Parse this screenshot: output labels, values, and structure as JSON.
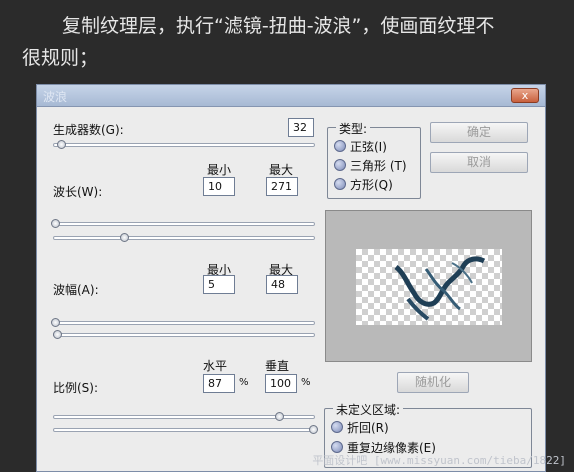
{
  "caption": {
    "line1": "复制纹理层，执行“滤镜-扭曲-波浪”，使画面纹理不",
    "line2": "很规则；"
  },
  "dialog": {
    "title": "波浪",
    "close": "x",
    "generators": {
      "label": "生成器数(G):",
      "value": "32"
    },
    "wavelength": {
      "label": "波长(W):",
      "min_label": "最小",
      "max_label": "最大",
      "min": "10",
      "max": "271"
    },
    "amplitude": {
      "label": "波幅(A):",
      "min_label": "最小",
      "max_label": "最大",
      "min": "5",
      "max": "48"
    },
    "scale": {
      "label": "比例(S):",
      "h_label": "水平",
      "v_label": "垂直",
      "h": "87",
      "v": "100",
      "unit": "%"
    },
    "type": {
      "title": "类型:",
      "options": [
        "正弦(I)",
        "三角形 (T)",
        "方形(Q)"
      ]
    },
    "buttons": {
      "ok": "确定",
      "cancel": "取消",
      "randomize": "随机化"
    },
    "undefined": {
      "title": "未定义区域:",
      "options": [
        "折回(R)",
        "重复边缘像素(E)"
      ]
    }
  },
  "watermark": "平面设计吧 [www.missyuan.com/tieba/1822]"
}
